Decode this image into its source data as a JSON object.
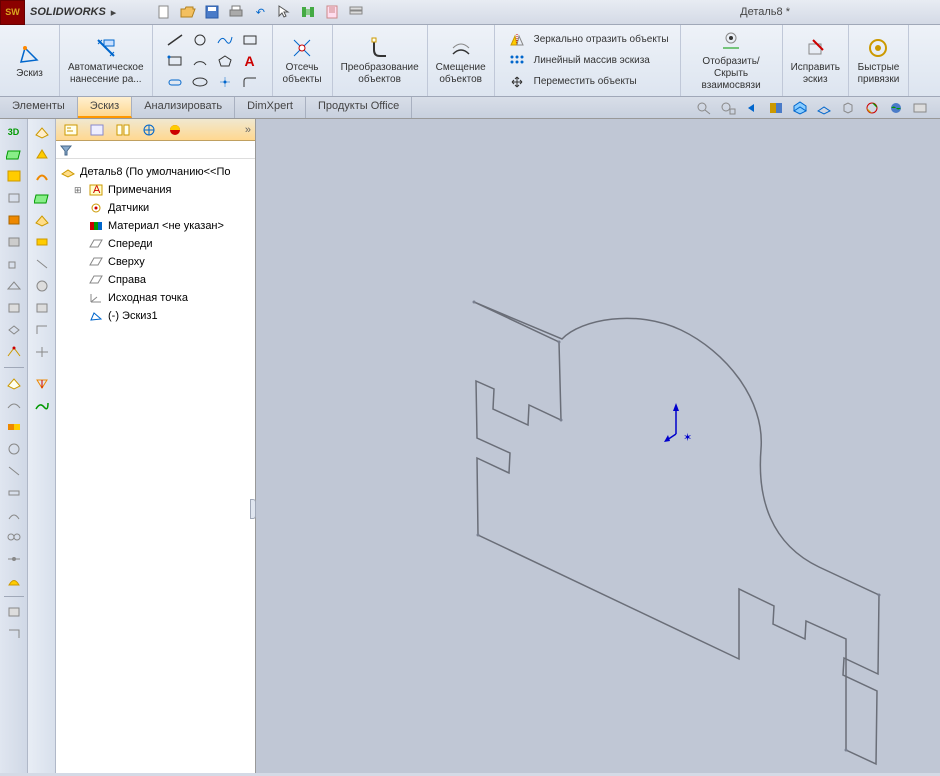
{
  "app": {
    "name_prefix": "SOLID",
    "name_suffix": "WORKS"
  },
  "document": {
    "title": "Деталь8 *"
  },
  "ribbon": {
    "sketch_label": "Эскиз",
    "auto_dim_label": "Автоматическое\nнанесение ра...",
    "trim_label": "Отсечь\nобъекты",
    "convert_label": "Преобразование\nобъектов",
    "offset_label": "Смещение\nобъектов",
    "mirror_label": "Зеркально отразить объекты",
    "pattern_label": "Линейный массив эскиза",
    "move_label": "Переместить объекты",
    "display_label": "Отобразить/Скрыть\nвзаимосвязи",
    "repair_label": "Исправить\nэскиз",
    "snaps_label": "Быстрые\nпривязки"
  },
  "tabs": {
    "elements": "Элементы",
    "sketch": "Эскиз",
    "analyze": "Анализировать",
    "dimxpert": "DimXpert",
    "office": "Продукты Office"
  },
  "tree": {
    "root": "Деталь8  (По умолчанию<<По",
    "annotations": "Примечания",
    "sensors": "Датчики",
    "material": "Материал <не указан>",
    "front": "Спереди",
    "top": "Сверху",
    "right": "Справа",
    "origin": "Исходная точка",
    "sketch1": "(-) Эскиз1"
  }
}
